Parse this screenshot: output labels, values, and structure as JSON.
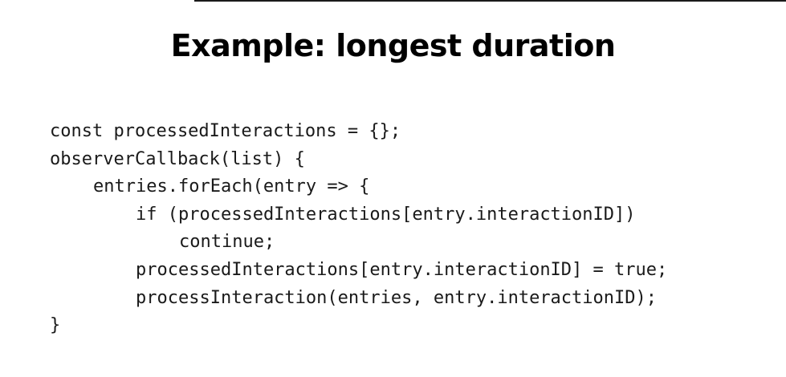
{
  "slide": {
    "title": "Example: longest duration"
  },
  "code": {
    "lines": [
      "const processedInteractions = {};",
      "observerCallback(list) {",
      "entries.forEach(entry => {",
      "if (processedInteractions[entry.interactionID])",
      "continue;",
      "processedInteractions[entry.interactionID] = true;",
      "processInteraction(entries, entry.interactionID);",
      "}"
    ]
  }
}
